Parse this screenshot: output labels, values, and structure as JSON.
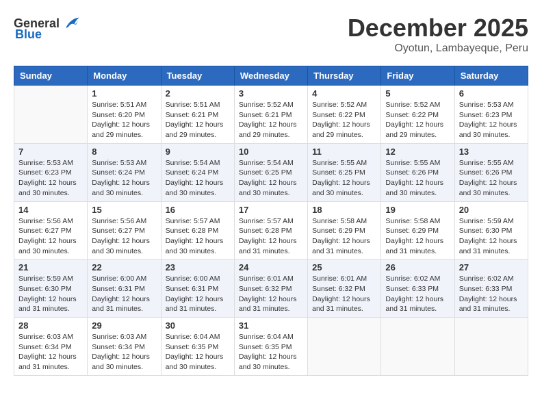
{
  "header": {
    "logo_general": "General",
    "logo_blue": "Blue",
    "month_year": "December 2025",
    "location": "Oyotun, Lambayeque, Peru"
  },
  "weekdays": [
    "Sunday",
    "Monday",
    "Tuesday",
    "Wednesday",
    "Thursday",
    "Friday",
    "Saturday"
  ],
  "weeks": [
    [
      {
        "day": "",
        "info": ""
      },
      {
        "day": "1",
        "info": "Sunrise: 5:51 AM\nSunset: 6:20 PM\nDaylight: 12 hours\nand 29 minutes."
      },
      {
        "day": "2",
        "info": "Sunrise: 5:51 AM\nSunset: 6:21 PM\nDaylight: 12 hours\nand 29 minutes."
      },
      {
        "day": "3",
        "info": "Sunrise: 5:52 AM\nSunset: 6:21 PM\nDaylight: 12 hours\nand 29 minutes."
      },
      {
        "day": "4",
        "info": "Sunrise: 5:52 AM\nSunset: 6:22 PM\nDaylight: 12 hours\nand 29 minutes."
      },
      {
        "day": "5",
        "info": "Sunrise: 5:52 AM\nSunset: 6:22 PM\nDaylight: 12 hours\nand 29 minutes."
      },
      {
        "day": "6",
        "info": "Sunrise: 5:53 AM\nSunset: 6:23 PM\nDaylight: 12 hours\nand 30 minutes."
      }
    ],
    [
      {
        "day": "7",
        "info": "Sunrise: 5:53 AM\nSunset: 6:23 PM\nDaylight: 12 hours\nand 30 minutes."
      },
      {
        "day": "8",
        "info": "Sunrise: 5:53 AM\nSunset: 6:24 PM\nDaylight: 12 hours\nand 30 minutes."
      },
      {
        "day": "9",
        "info": "Sunrise: 5:54 AM\nSunset: 6:24 PM\nDaylight: 12 hours\nand 30 minutes."
      },
      {
        "day": "10",
        "info": "Sunrise: 5:54 AM\nSunset: 6:25 PM\nDaylight: 12 hours\nand 30 minutes."
      },
      {
        "day": "11",
        "info": "Sunrise: 5:55 AM\nSunset: 6:25 PM\nDaylight: 12 hours\nand 30 minutes."
      },
      {
        "day": "12",
        "info": "Sunrise: 5:55 AM\nSunset: 6:26 PM\nDaylight: 12 hours\nand 30 minutes."
      },
      {
        "day": "13",
        "info": "Sunrise: 5:55 AM\nSunset: 6:26 PM\nDaylight: 12 hours\nand 30 minutes."
      }
    ],
    [
      {
        "day": "14",
        "info": "Sunrise: 5:56 AM\nSunset: 6:27 PM\nDaylight: 12 hours\nand 30 minutes."
      },
      {
        "day": "15",
        "info": "Sunrise: 5:56 AM\nSunset: 6:27 PM\nDaylight: 12 hours\nand 30 minutes."
      },
      {
        "day": "16",
        "info": "Sunrise: 5:57 AM\nSunset: 6:28 PM\nDaylight: 12 hours\nand 30 minutes."
      },
      {
        "day": "17",
        "info": "Sunrise: 5:57 AM\nSunset: 6:28 PM\nDaylight: 12 hours\nand 31 minutes."
      },
      {
        "day": "18",
        "info": "Sunrise: 5:58 AM\nSunset: 6:29 PM\nDaylight: 12 hours\nand 31 minutes."
      },
      {
        "day": "19",
        "info": "Sunrise: 5:58 AM\nSunset: 6:29 PM\nDaylight: 12 hours\nand 31 minutes."
      },
      {
        "day": "20",
        "info": "Sunrise: 5:59 AM\nSunset: 6:30 PM\nDaylight: 12 hours\nand 31 minutes."
      }
    ],
    [
      {
        "day": "21",
        "info": "Sunrise: 5:59 AM\nSunset: 6:30 PM\nDaylight: 12 hours\nand 31 minutes."
      },
      {
        "day": "22",
        "info": "Sunrise: 6:00 AM\nSunset: 6:31 PM\nDaylight: 12 hours\nand 31 minutes."
      },
      {
        "day": "23",
        "info": "Sunrise: 6:00 AM\nSunset: 6:31 PM\nDaylight: 12 hours\nand 31 minutes."
      },
      {
        "day": "24",
        "info": "Sunrise: 6:01 AM\nSunset: 6:32 PM\nDaylight: 12 hours\nand 31 minutes."
      },
      {
        "day": "25",
        "info": "Sunrise: 6:01 AM\nSunset: 6:32 PM\nDaylight: 12 hours\nand 31 minutes."
      },
      {
        "day": "26",
        "info": "Sunrise: 6:02 AM\nSunset: 6:33 PM\nDaylight: 12 hours\nand 31 minutes."
      },
      {
        "day": "27",
        "info": "Sunrise: 6:02 AM\nSunset: 6:33 PM\nDaylight: 12 hours\nand 31 minutes."
      }
    ],
    [
      {
        "day": "28",
        "info": "Sunrise: 6:03 AM\nSunset: 6:34 PM\nDaylight: 12 hours\nand 31 minutes."
      },
      {
        "day": "29",
        "info": "Sunrise: 6:03 AM\nSunset: 6:34 PM\nDaylight: 12 hours\nand 30 minutes."
      },
      {
        "day": "30",
        "info": "Sunrise: 6:04 AM\nSunset: 6:35 PM\nDaylight: 12 hours\nand 30 minutes."
      },
      {
        "day": "31",
        "info": "Sunrise: 6:04 AM\nSunset: 6:35 PM\nDaylight: 12 hours\nand 30 minutes."
      },
      {
        "day": "",
        "info": ""
      },
      {
        "day": "",
        "info": ""
      },
      {
        "day": "",
        "info": ""
      }
    ]
  ]
}
